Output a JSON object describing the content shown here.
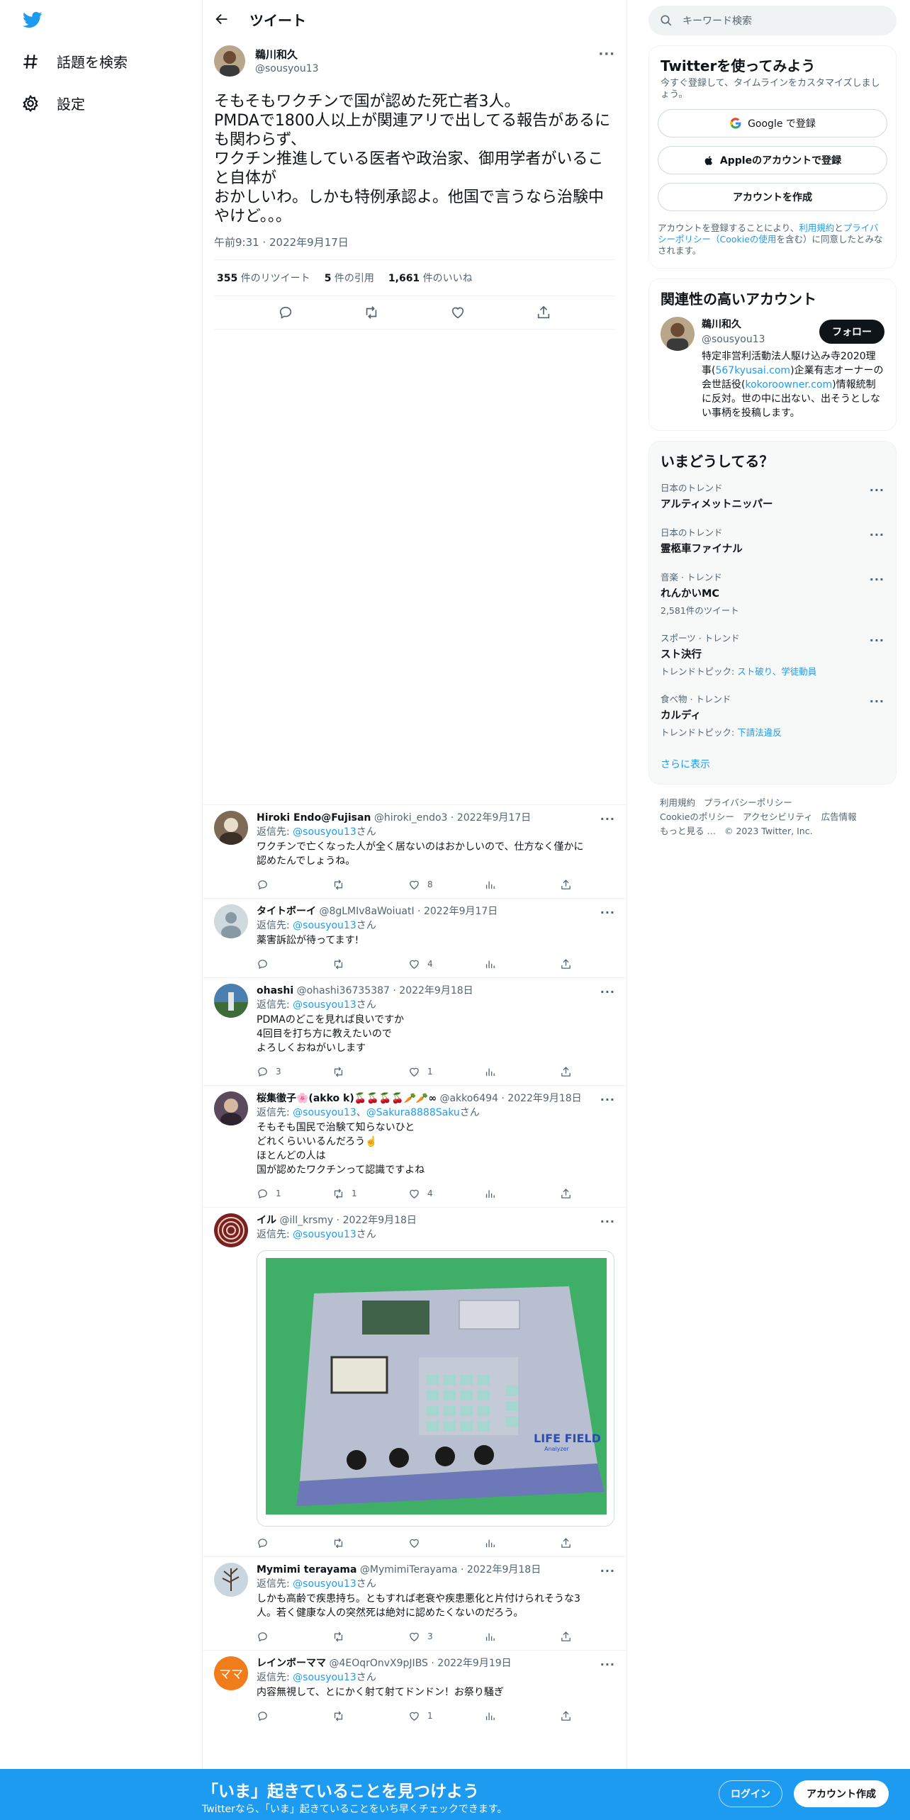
{
  "nav": {
    "explore_label": "話題を検索",
    "settings_label": "設定"
  },
  "header": {
    "title": "ツイート"
  },
  "main_tweet": {
    "name": "鵜川和久",
    "handle": "@sousyou13",
    "text": "そもそもワクチンで国が認めた死亡者3人。\nPMDAで1800人以上が関連アリで出してる報告があるにも関わらず、\nワクチン推進している医者や政治家、御用学者がいること自体が\nおかしいわ。しかも特例承認よ。他国で言うなら治験中やけど。。。",
    "time": "午前9:31 · 2022年9月17日",
    "retweets_count": "355",
    "retweets_label": "件のリツイート",
    "quotes_count": "5",
    "quotes_label": "件の引用",
    "likes_count": "1,661",
    "likes_label": "件のいいね"
  },
  "reply_prefix": "返信先: ",
  "reply_suffix": "さん",
  "replies": [
    {
      "name": "Hiroki Endo@Fujisan",
      "handle": "@hiroki_endo3",
      "date": "2022年9月17日",
      "to": "@sousyou13",
      "text": "ワクチンで亡くなった人が全く居ないのはおかしいので、仕方なく僅かに\n認めたんでしょうね。",
      "reply_count": "",
      "retweet_count": "",
      "like_count": "8"
    },
    {
      "name": "タイトボーイ",
      "handle": "@8gLMIv8aWoiuatI",
      "date": "2022年9月17日",
      "to": "@sousyou13",
      "text": "薬害訴訟が待ってます!",
      "reply_count": "",
      "retweet_count": "",
      "like_count": "4"
    },
    {
      "name": "ohashi",
      "handle": "@ohashi36735387",
      "date": "2022年9月18日",
      "to": "@sousyou13",
      "text": "PDMAのどこを見れば良いですか\n4回目を打ち方に教えたいので\nよろしくおねがいします",
      "reply_count": "3",
      "retweet_count": "",
      "like_count": "1"
    },
    {
      "name": "桜集徹子🌸(akko k)🍒🍒🍒🍒🥕🥕∞",
      "handle": "@akko6494",
      "date": "2022年9月18日",
      "to": "@sousyou13",
      "to2": "@Sakura8888Saku",
      "text": "そもそも国民で治験て知らないひと\nどれくらいいるんだろう☝️\nほとんどの人は\n国が認めたワクチンって認識ですよね",
      "reply_count": "1",
      "retweet_count": "1",
      "like_count": "4"
    },
    {
      "name": "イル",
      "handle": "@ill_krsmy",
      "date": "2022年9月18日",
      "to": "@sousyou13",
      "text": "",
      "reply_count": "",
      "retweet_count": "",
      "like_count": ""
    },
    {
      "name": "Mymimi terayama",
      "handle": "@MymimiTerayama",
      "date": "2022年9月18日",
      "to": "@sousyou13",
      "text": "しかも高齢で疾患持ち。ともすれば老衰や疾患悪化と片付けられそうな3\n人。若く健康な人の突然死は絶対に認めたくないのだろう。",
      "reply_count": "",
      "retweet_count": "",
      "like_count": "3"
    },
    {
      "name": "レインボーママ",
      "handle": "@4EOqrOnvX9pJIBS",
      "date": "2022年9月19日",
      "to": "@sousyou13",
      "text": "内容無視して、とにかく射て射てドンドン！お祭り騒ぎ",
      "reply_count": "",
      "retweet_count": "",
      "like_count": "1"
    }
  ],
  "media_text": {
    "brand": "LIFE FIELD",
    "model": "Analyzer"
  },
  "avatar_text": {
    "rainbow": "ママ"
  },
  "search": {
    "placeholder": "キーワード検索"
  },
  "signup": {
    "title": "Twitterを使ってみよう",
    "desc": "今すぐ登録して、タイムラインをカスタマイズしましょう。",
    "google": "Google で登録",
    "apple": "Appleのアカウントで登録",
    "create": "アカウントを作成",
    "terms_1": "アカウントを登録することにより、",
    "terms_tos": "利用規約",
    "terms_2": "と",
    "terms_pp": "プライバシーポリシー（Cookieの使用",
    "terms_3": "を含む）に同意したとみなされます。"
  },
  "related": {
    "title": "関連性の高いアカウント",
    "name": "鵜川和久",
    "handle": "@sousyou13",
    "follow": "フォロー",
    "bio_1": "特定非営利活動法人駆け込み寺2020理事(",
    "bio_link1": "567kyusai.com",
    "bio_2": ")企業有志オーナーの会世話役(",
    "bio_link2": "kokoroowner.com",
    "bio_3": ")情報統制に反対。世の中に出ない、出そうとしない事柄を投稿します。"
  },
  "trends": {
    "title": "いまどうしてる？",
    "items": [
      {
        "category": "日本のトレンド",
        "name": "アルティメットニッパー",
        "sub": ""
      },
      {
        "category": "日本のトレンド",
        "name": "霊柩車ファイナル",
        "sub": ""
      },
      {
        "category": "音楽 · トレンド",
        "name": "れんかいMC",
        "sub": "2,581件のツイート"
      },
      {
        "category": "スポーツ · トレンド",
        "name": "スト決行",
        "sub_label": "トレンドトピック: ",
        "sub_links": "スト破り、学徒動員"
      },
      {
        "category": "食べ物 · トレンド",
        "name": "カルディ",
        "sub_label": "トレンドトピック: ",
        "sub_links": "下請法違反"
      }
    ],
    "show_more": "さらに表示"
  },
  "footer": {
    "tos": "利用規約",
    "privacy": "プライバシーポリシー",
    "cookie": "Cookieのポリシー",
    "accessibility": "アクセシビリティ",
    "ads": "広告情報",
    "more": "もっと見る …",
    "copyright": "© 2023 Twitter, Inc."
  },
  "bottom": {
    "title": "「いま」起きていることを見つけよう",
    "sub": "Twitterなら、「いま」起きていることをいち早くチェックできます。",
    "login": "ログイン",
    "create": "アカウント作成"
  },
  "colors": {
    "brand": "#1d9bf0",
    "text": "#0f1419",
    "muted": "#536471"
  }
}
